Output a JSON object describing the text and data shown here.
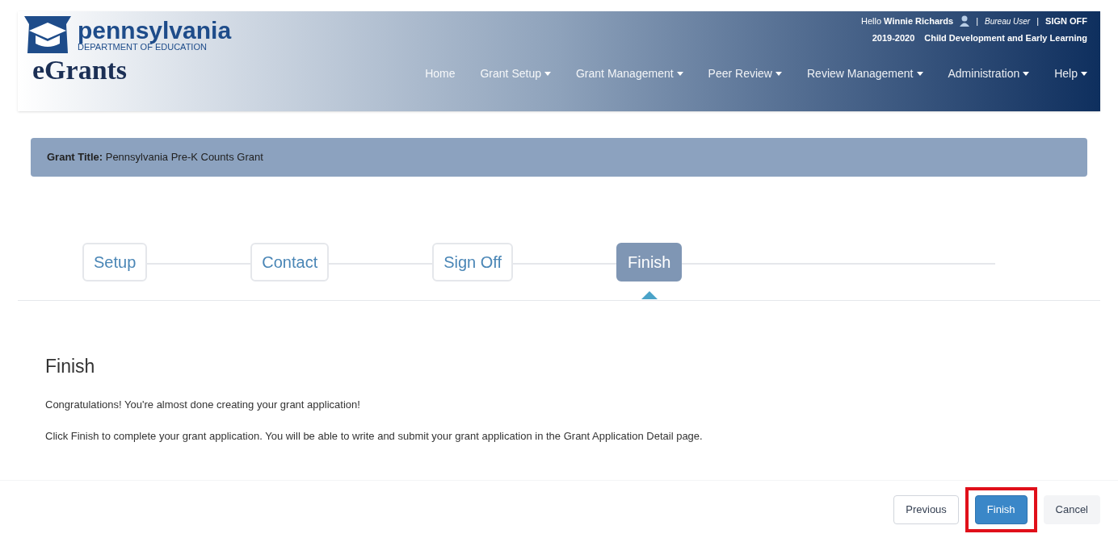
{
  "header": {
    "logo": {
      "name": "pennsylvania",
      "subtitle": "DEPARTMENT OF EDUCATION"
    },
    "app_name": "eGrants",
    "greeting": "Hello",
    "user_name": "Winnie Richards",
    "separator": "|",
    "role": "Bureau User",
    "sign_off": "SIGN OFF",
    "year": "2019-2020",
    "office": "Child Development and Early Learning",
    "nav": [
      {
        "label": "Home",
        "dropdown": false
      },
      {
        "label": "Grant Setup",
        "dropdown": true
      },
      {
        "label": "Grant Management",
        "dropdown": true
      },
      {
        "label": "Peer Review",
        "dropdown": true
      },
      {
        "label": "Review Management",
        "dropdown": true
      },
      {
        "label": "Administration",
        "dropdown": true
      },
      {
        "label": "Help",
        "dropdown": true
      }
    ]
  },
  "grant_bar": {
    "label": "Grant Title:",
    "value": "Pennsylvania Pre-K Counts Grant"
  },
  "steps": [
    {
      "label": "Setup",
      "selected": false
    },
    {
      "label": "Contact",
      "selected": false
    },
    {
      "label": "Sign Off",
      "selected": false
    },
    {
      "label": "Finish",
      "selected": true
    }
  ],
  "content": {
    "heading": "Finish",
    "paragraphs": [
      "Congratulations! You're almost done creating your grant application!",
      "Click Finish to complete your grant application. You will be able to write and submit your grant application in the Grant Application Detail page."
    ]
  },
  "buttons": [
    {
      "label": "Previous",
      "kind": "default",
      "highlighted": false
    },
    {
      "label": "Finish",
      "kind": "primary",
      "highlighted": true
    },
    {
      "label": "Cancel",
      "kind": "muted",
      "highlighted": false
    }
  ]
}
